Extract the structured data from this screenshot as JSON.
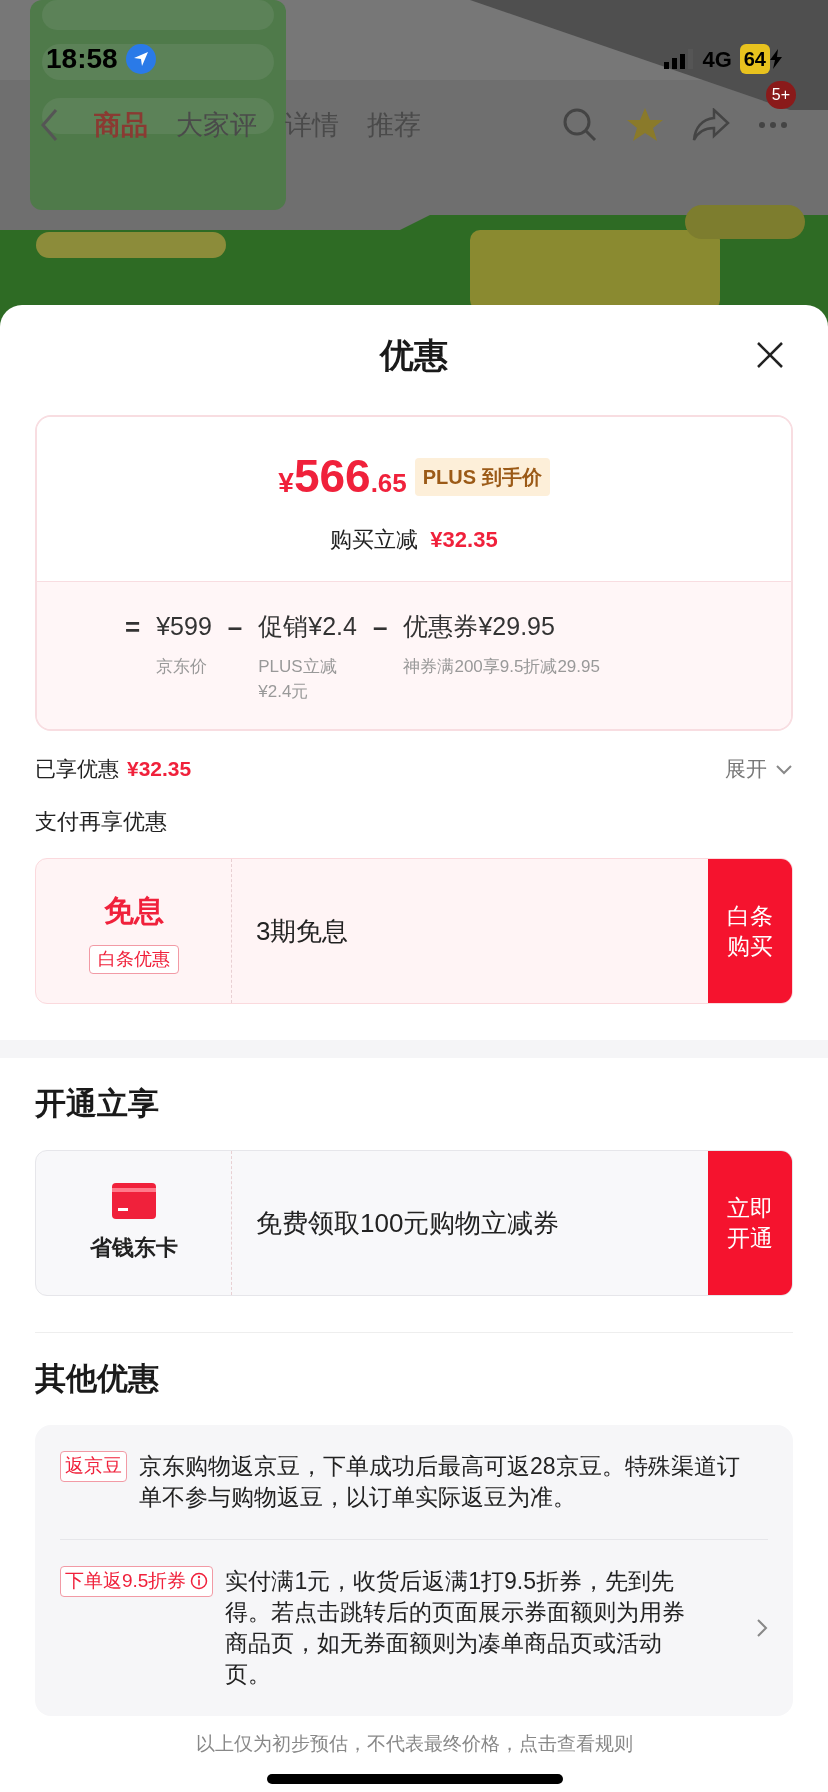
{
  "status_bar": {
    "time": "18:58",
    "network": "4G",
    "battery": "64"
  },
  "nav": {
    "tabs": [
      {
        "label": "商品",
        "selected": true
      },
      {
        "label": "大家评",
        "selected": false
      },
      {
        "label": "详情",
        "selected": false
      },
      {
        "label": "推荐",
        "selected": false
      }
    ],
    "badge": "5+"
  },
  "sheet": {
    "title": "优惠"
  },
  "price_card": {
    "symbol": "¥",
    "price_int": "566",
    "price_dec": ".65",
    "tag": "PLUS 到手价",
    "reduce_label": "购买立减",
    "reduce_amount": "¥32.35",
    "equals": "=",
    "items": [
      {
        "amount": "¥599",
        "note_lines": [
          "京东价"
        ]
      },
      {
        "op": "–",
        "amount": "促销¥2.4",
        "note_lines": [
          "PLUS立减",
          "¥2.4元"
        ]
      },
      {
        "op": "–",
        "amount": "优惠券¥29.95",
        "note_lines": [
          "神券满200享9.5折减29.95"
        ]
      }
    ]
  },
  "enjoyed": {
    "label": "已享优惠",
    "amount": "¥32.35",
    "toggle": "展开",
    "expanded": false
  },
  "pay_section": {
    "title": "支付再享优惠",
    "offer": {
      "kind": "text",
      "title": "免息",
      "tag": "白条优惠",
      "desc": "3期免息",
      "button": "白条购买"
    }
  },
  "open_section": {
    "title": "开通立享",
    "offer": {
      "kind": "card",
      "name": "省钱东卡",
      "desc": "免费领取100元购物立减券",
      "button": "立即开通"
    }
  },
  "other_section": {
    "title": "其他优惠",
    "items": [
      {
        "tag": "返京豆",
        "info": false,
        "chevron": false,
        "text": "京东购物返京豆，下单成功后最高可返28京豆。特殊渠道订单不参与购物返豆，以订单实际返豆为准。"
      },
      {
        "tag": "下单返9.5折券",
        "info": true,
        "chevron": true,
        "text": "实付满1元，收货后返满1打9.5折券，先到先得。若点击跳转后的页面展示券面额则为用券商品页，如无券面额则为凑单商品页或活动页。"
      }
    ]
  },
  "footer": "以上仅为初步预估，不代表最终价格，点击查看规则"
}
